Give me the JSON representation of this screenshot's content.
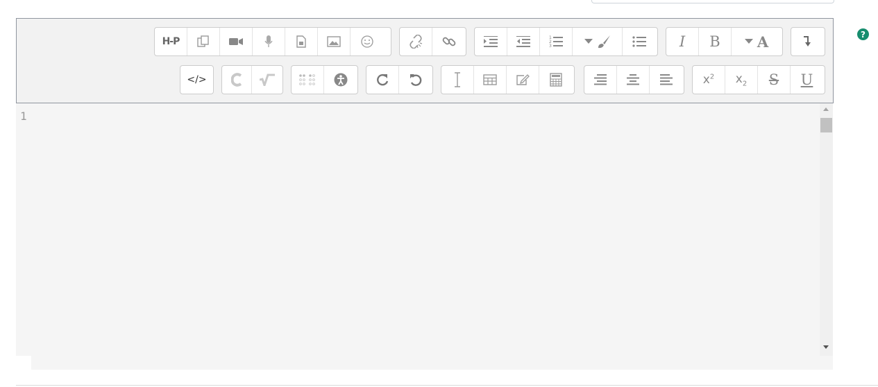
{
  "toolbar": {
    "row1": [
      [
        "h5p-icon",
        "insert-h5p"
      ],
      [
        "paste-icon",
        "paste-unformatted-text"
      ],
      [
        "video-icon",
        "insert-video"
      ],
      [
        "microphone-icon",
        "record-audio"
      ],
      [
        "media-icon",
        "insert-media"
      ],
      [
        "image-icon",
        "insert-image"
      ],
      [
        "emoji-icon",
        "insert-emoji"
      ],
      [
        "unlink-icon",
        "unlink"
      ],
      [
        "link-icon",
        "insert-link"
      ],
      [
        "indent-icon",
        "indent"
      ],
      [
        "outdent-icon",
        "outdent"
      ],
      [
        "ordered-list-icon",
        "ordered-list"
      ],
      [
        "paragraph-styles-icon",
        "paragraph-styles"
      ],
      [
        "unordered-list-icon",
        "unordered-list"
      ],
      [
        "italic-icon",
        "italic"
      ],
      [
        "bold-icon",
        "bold"
      ],
      [
        "font-color-icon",
        "font-color"
      ],
      [
        "toolbar-toggle-icon",
        "show-more-buttons"
      ]
    ],
    "row2": [
      [
        "html-icon",
        "html-source"
      ],
      [
        "chemistry-icon",
        "chemistry-editor"
      ],
      [
        "equation-icon",
        "equation-editor"
      ],
      [
        "braille-icon",
        "screenreader-helper"
      ],
      [
        "accessibility-icon",
        "accessibility-checker"
      ],
      [
        "redo-icon",
        "redo"
      ],
      [
        "undo-icon",
        "undo"
      ],
      [
        "clear-formatting-icon",
        "clear-formatting"
      ],
      [
        "table-icon",
        "insert-table"
      ],
      [
        "edit-icon",
        "manage-files"
      ],
      [
        "calculator-icon",
        "calculator"
      ],
      [
        "align-right-icon",
        "align-right"
      ],
      [
        "align-center-icon",
        "align-center"
      ],
      [
        "align-left-icon",
        "align-left"
      ],
      [
        "superscript-icon",
        "superscript"
      ],
      [
        "subscript-icon",
        "subscript"
      ],
      [
        "strikethrough-icon",
        "strikethrough"
      ],
      [
        "underline-icon",
        "underline"
      ]
    ],
    "labels": {
      "italic": "I",
      "bold": "B",
      "font_color": "A",
      "underline": "U",
      "strike": "S",
      "sup_base": "x",
      "sup_mark": "2",
      "sub_base": "x",
      "sub_mark": "2",
      "html": "</>",
      "h5p": "H-P"
    }
  },
  "help": {
    "symbol": "?"
  },
  "editor": {
    "line_numbers": [
      "1"
    ],
    "content": ""
  },
  "colors": {
    "toolbar_bg": "#f2f2f2",
    "icon": "#888888",
    "help": "#178d6e",
    "editor_bg": "#f5f5f5"
  }
}
